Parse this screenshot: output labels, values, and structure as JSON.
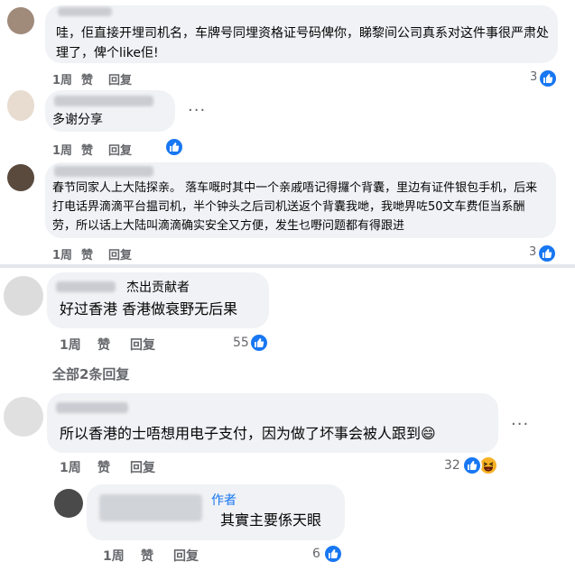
{
  "comments": [
    {
      "text": "哇，佢直接开埋司机名，车牌号同埋资格证号码俾你，睇黎间公司真系对这件事很严肃处理了，俾个like佢!",
      "time": "1周",
      "like": "赞",
      "reply": "回复",
      "reactions": "3"
    },
    {
      "text": "多谢分享",
      "time": "1周",
      "like": "赞",
      "reply": "回复",
      "reactions": ""
    },
    {
      "text": "春节同家人上大陆探亲。 落车嘅时其中一个亲戚唔记得攞个背囊，里边有证件银包手机，后来打电话畀滴滴平台揾司机，半个钟头之后司机送返个背囊我哋，我哋畀咗50文车费佢当系酬劳，所以话上大陆叫滴滴确实安全又方便，发生乜嘢问题都有得跟进",
      "time": "1周",
      "like": "赞",
      "reply": "回复",
      "reactions": "3"
    },
    {
      "badge": "杰出贡献者",
      "text": "好过香港 香港做衰野无后果",
      "time": "1周",
      "like": "赞",
      "reply": "回复",
      "reactions": "55",
      "view_replies": "全部2条回复"
    },
    {
      "text": "所以香港的士唔想用电子支付，因为做了坏事会被人跟到😄",
      "time": "1周",
      "like": "赞",
      "reply": "回复",
      "reactions": "32"
    },
    {
      "badge": "作者",
      "text": "其實主要係天眼",
      "time": "1周",
      "like": "赞",
      "reply": "回复",
      "reactions": "6"
    }
  ],
  "more_icon": "more-dots-icon",
  "colors": {
    "like_blue": "#1877f2",
    "bubble": "#f0f2f5",
    "meta_gray": "#65676b",
    "author_blue": "#1877f2"
  }
}
